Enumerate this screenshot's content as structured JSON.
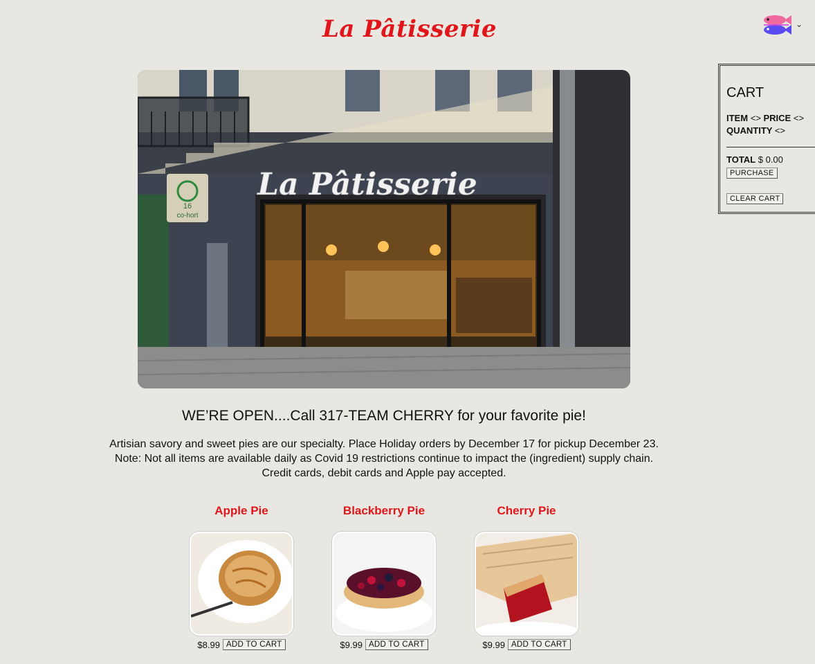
{
  "header": {
    "brand": "La Pâtisserie",
    "storefront_sign": "La Pâtisserie",
    "wall_sign_top": "16",
    "wall_sign_bottom": "co-hort"
  },
  "main": {
    "headline": "WE’RE OPEN....Call 317-TEAM CHERRY for your favorite pie!",
    "intro_lines": [
      "Artisian savory and sweet pies are our specialty. Place Holiday orders by December 17 for pickup December 23.",
      "Note: Not all items are available daily as Covid 19 restrictions continue to impact the (ingredient) supply chain.",
      "Credit cards, debit cards and Apple pay accepted."
    ]
  },
  "products": [
    {
      "name": "Apple Pie",
      "price": "$8.99",
      "button": "ADD TO CART"
    },
    {
      "name": "Blackberry Pie",
      "price": "$9.99",
      "button": "ADD TO CART"
    },
    {
      "name": "Cherry Pie",
      "price": "$9.99",
      "button": "ADD TO CART"
    }
  ],
  "cart": {
    "title": "CART",
    "col_item": "ITEM",
    "col_price": "PRICE",
    "col_quantity": "QUANTITY",
    "sort_glyph": "<>",
    "total_label": "TOTAL",
    "total_value": "$ 0.00",
    "purchase_label": "PURCHASE",
    "clear_label": "CLEAR CART"
  },
  "icons": {
    "account_menu": "fish-logo-icon",
    "dropdown": "chevron-down-icon"
  },
  "colors": {
    "brand": "#e0161b",
    "background": "#e8e7e1"
  }
}
